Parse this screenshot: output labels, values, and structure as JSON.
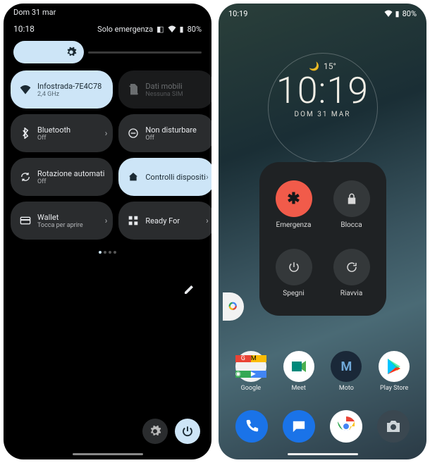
{
  "left": {
    "top_date": "Dom 31 mar",
    "status": {
      "time": "10:18",
      "label": "Solo emergenza",
      "battery": "80%"
    },
    "brightness_icon": "gear",
    "tiles": [
      {
        "id": "wifi",
        "state": "on",
        "title": "Infostrada-7E4C78",
        "sub": "2,4 GHz",
        "chev": true
      },
      {
        "id": "data",
        "state": "dim",
        "title": "Dati mobili",
        "sub": "Nessuna SIM",
        "chev": false
      },
      {
        "id": "bt",
        "state": "off",
        "title": "Bluetooth",
        "sub": "Off",
        "chev": true
      },
      {
        "id": "dnd",
        "state": "off",
        "title": "Non disturbare",
        "sub": "Off",
        "chev": false
      },
      {
        "id": "rotation",
        "state": "off",
        "title": "Rotazione automati",
        "sub": "Off",
        "chev": false
      },
      {
        "id": "devctrl",
        "state": "on",
        "title": "Controlli dispositi",
        "sub": "",
        "chev": true
      },
      {
        "id": "wallet",
        "state": "off",
        "title": "Wallet",
        "sub": "Tocca per aprire",
        "chev": true
      },
      {
        "id": "readyfor",
        "state": "off",
        "title": "Ready For",
        "sub": "",
        "chev": true
      }
    ]
  },
  "right": {
    "status": {
      "time": "10:19",
      "battery": "80%"
    },
    "clock": {
      "temp": "15°",
      "time": "10:19",
      "date": "DOM 31 MAR"
    },
    "powermenu": [
      {
        "id": "emergency",
        "label": "Emergenza"
      },
      {
        "id": "lock",
        "label": "Blocca"
      },
      {
        "id": "shutdown",
        "label": "Spegni"
      },
      {
        "id": "restart",
        "label": "Riavvia"
      }
    ],
    "apps": [
      {
        "id": "google",
        "label": "Google"
      },
      {
        "id": "meet",
        "label": "Meet"
      },
      {
        "id": "moto",
        "label": "Moto"
      },
      {
        "id": "playstore",
        "label": "Play Store"
      }
    ],
    "dock": [
      "phone",
      "messages",
      "chrome",
      "camera"
    ]
  }
}
